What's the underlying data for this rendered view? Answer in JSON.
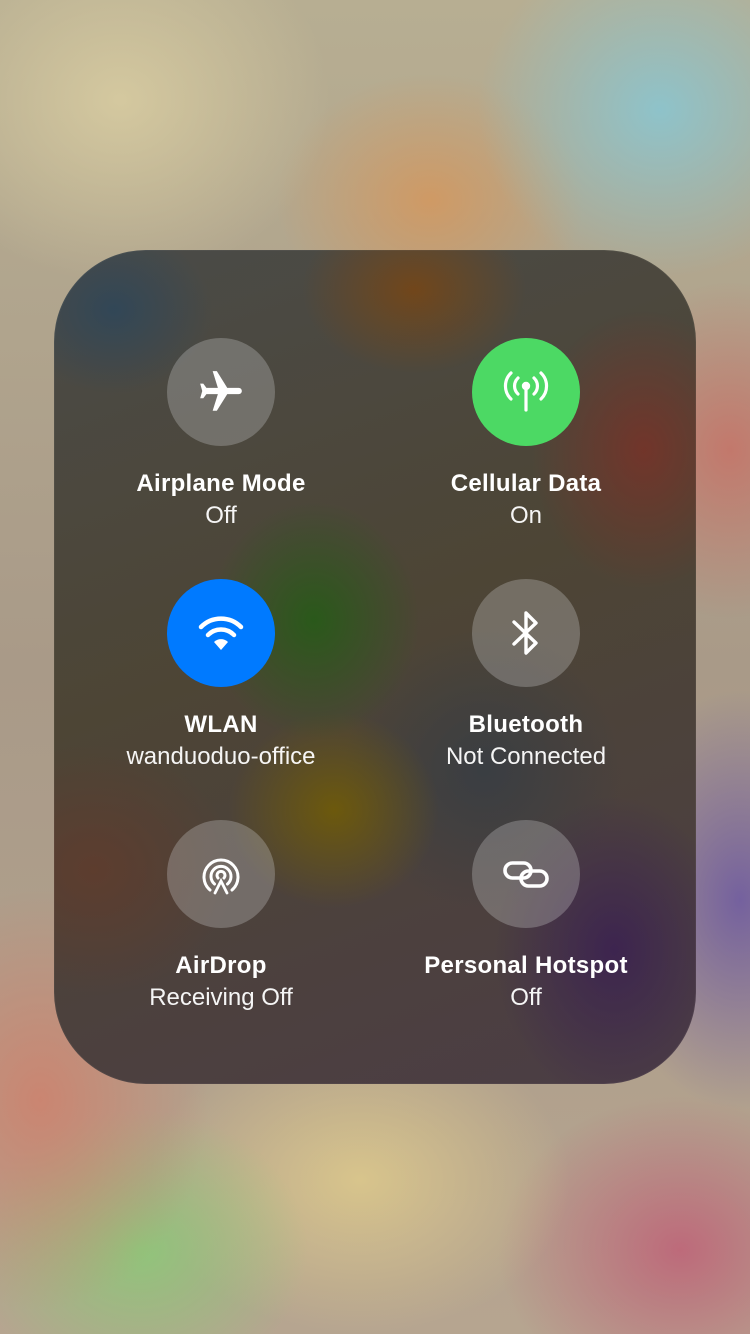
{
  "connectivity": {
    "airplane": {
      "label": "Airplane Mode",
      "status": "Off",
      "icon": "airplane-icon",
      "active": false
    },
    "cellular": {
      "label": "Cellular Data",
      "status": "On",
      "icon": "antenna-icon",
      "active": true,
      "color": "#4cd964"
    },
    "wlan": {
      "label": "WLAN",
      "status": "wanduoduo-office",
      "icon": "wifi-icon",
      "active": true,
      "color": "#007aff"
    },
    "bluetooth": {
      "label": "Bluetooth",
      "status": "Not Connected",
      "icon": "bluetooth-icon",
      "active": false
    },
    "airdrop": {
      "label": "AirDrop",
      "status": "Receiving Off",
      "icon": "airdrop-icon",
      "active": false
    },
    "hotspot": {
      "label": "Personal Hotspot",
      "status": "Off",
      "icon": "link-icon",
      "active": false
    }
  }
}
